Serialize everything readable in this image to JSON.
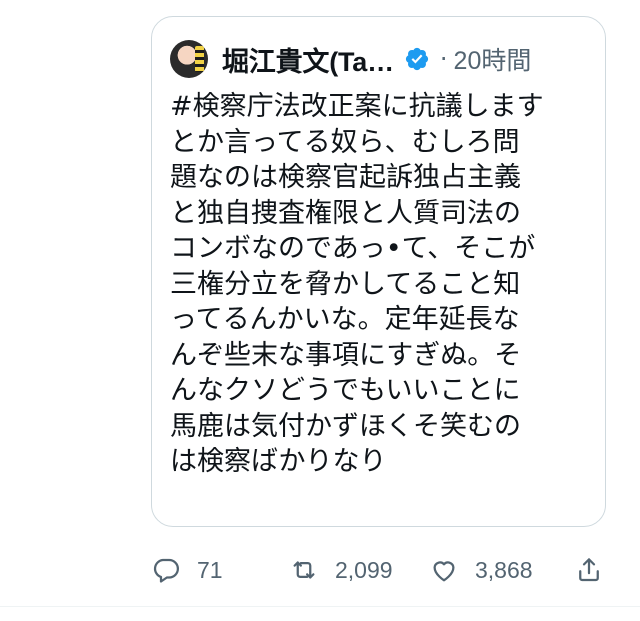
{
  "quote": {
    "author_name": "堀江貴文(Ta…",
    "verified_icon": "verified-badge-icon",
    "separator": "·",
    "time": "20時間",
    "text": "#検察庁法改正案に抗議します\nとか言ってる奴ら、むしろ問\n題なのは検察官起訴独占主義\nと独自捜査権限と人質司法の\nコンボなのであっ•て、そこが\n三権分立を脅かしてること知\nってるんかいな。定年延長な\nんぞ些末な事項にすぎぬ。そ\nんなクソどうでもいいことに\n馬鹿は気付かずほくそ笑むの\nは検察ばかりなり"
  },
  "actions": {
    "reply_count": "71",
    "retweet_count": "2,099",
    "like_count": "3,868"
  },
  "colors": {
    "verified": "#1d9bf0",
    "muted": "#536471",
    "border": "#cfd9de"
  }
}
